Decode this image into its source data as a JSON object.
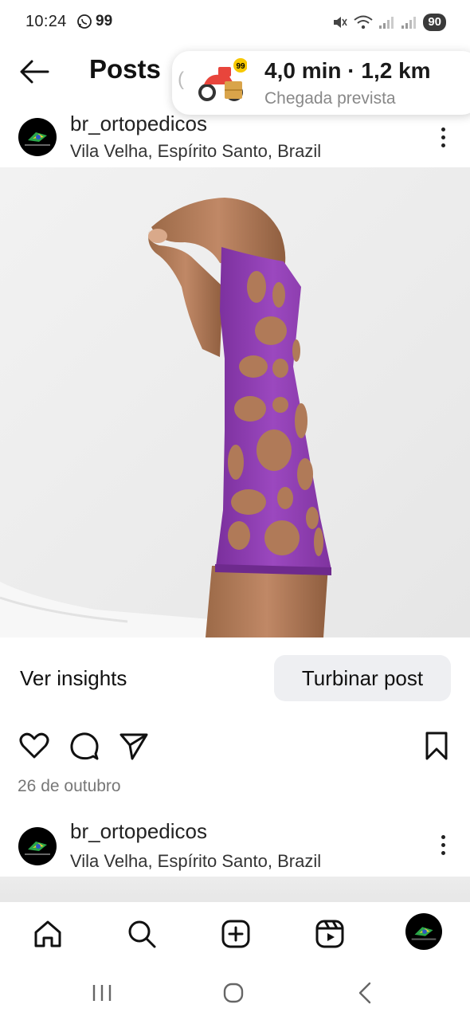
{
  "status_bar": {
    "time": "10:24",
    "notification_badge": "99",
    "battery": "90"
  },
  "header": {
    "title": "Posts"
  },
  "delivery_banner": {
    "eta": "4,0 min · 1,2 km",
    "subtitle": "Chegada prevista",
    "badge": "99",
    "partial_text": "("
  },
  "post": {
    "username": "br_ortopedicos",
    "location": "Vila Velha, Espírito Santo, Brazil",
    "image_icon": "purple-3d-printed-wrist-cast-photo",
    "insights_label": "Ver insights",
    "boost_label": "Turbinar post",
    "date": "26 de outubro"
  },
  "next_post": {
    "username": "br_ortopedicos",
    "location": "Vila Velha, Espírito Santo, Brazil"
  },
  "bottom_nav": {
    "items": [
      "home-icon",
      "search-icon",
      "create-icon",
      "reels-icon",
      "profile-avatar"
    ]
  },
  "system_nav": {
    "items": [
      "recent-apps-icon",
      "home-circle-icon",
      "back-chevron-icon"
    ]
  },
  "colors": {
    "cast_purple": "#8e3bb0",
    "boost_button_bg": "#eeeff2"
  }
}
